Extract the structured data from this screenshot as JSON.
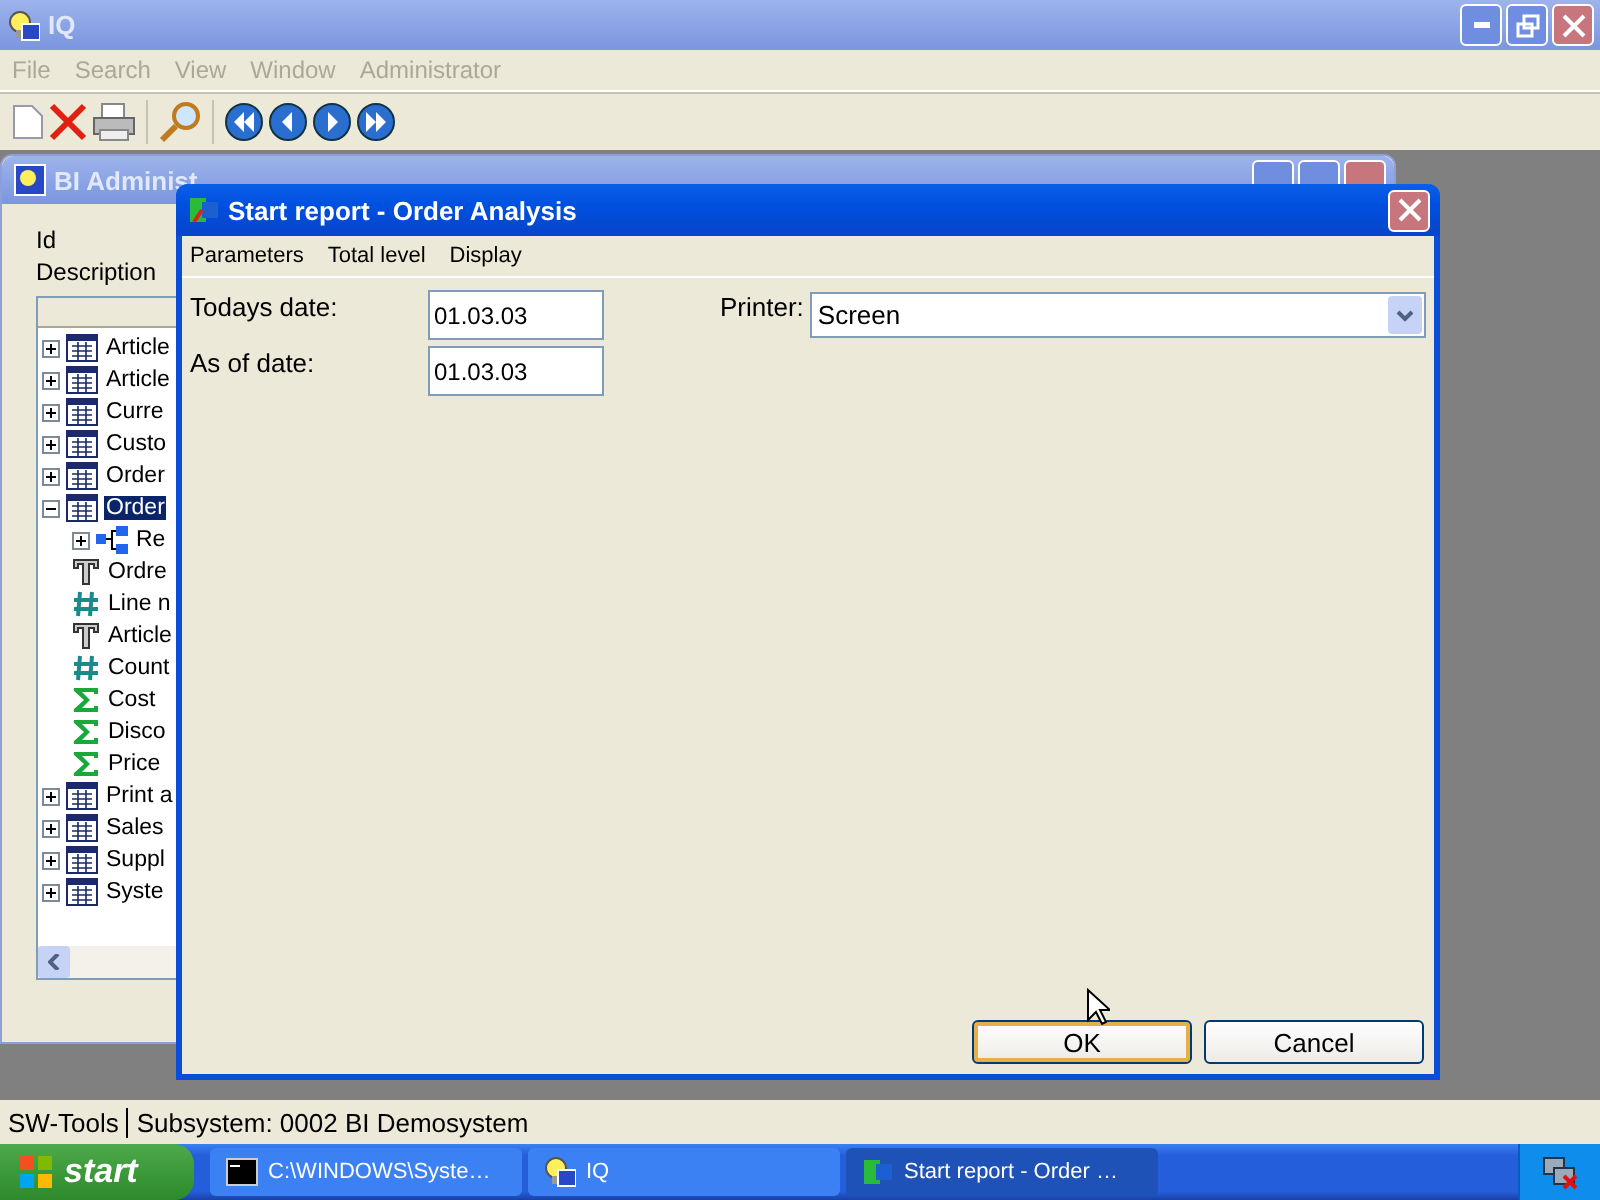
{
  "window": {
    "title": "IQ"
  },
  "menu": [
    {
      "label": "File",
      "disabled": true
    },
    {
      "label": "Search",
      "disabled": true
    },
    {
      "label": "View",
      "disabled": true
    },
    {
      "label": "Window",
      "disabled": true
    },
    {
      "label": "Administrator",
      "disabled": true
    }
  ],
  "child_window": {
    "title": "BI Administ",
    "labels": [
      "Id",
      "Description"
    ],
    "tree": [
      {
        "label": "Article",
        "kind": "table",
        "expanded": false,
        "selected": false
      },
      {
        "label": "Article",
        "kind": "table",
        "expanded": false,
        "selected": false
      },
      {
        "label": "Curre",
        "kind": "table",
        "expanded": false,
        "selected": false
      },
      {
        "label": "Custo",
        "kind": "table",
        "expanded": false,
        "selected": false
      },
      {
        "label": "Order",
        "kind": "table",
        "expanded": false,
        "selected": false
      },
      {
        "label": "Order",
        "kind": "table",
        "expanded": true,
        "selected": true,
        "children": [
          {
            "label": "Re",
            "kind": "relation",
            "expanded": false,
            "selected": false
          },
          {
            "label": "Ordre",
            "kind": "text",
            "selected": false
          },
          {
            "label": "Line n",
            "kind": "number",
            "selected": false
          },
          {
            "label": "Article",
            "kind": "text",
            "selected": false
          },
          {
            "label": "Count",
            "kind": "number",
            "selected": false
          },
          {
            "label": "Cost",
            "kind": "sum",
            "selected": false
          },
          {
            "label": "Disco",
            "kind": "sum",
            "selected": false
          },
          {
            "label": "Price",
            "kind": "sum",
            "selected": false
          }
        ]
      },
      {
        "label": "Print a",
        "kind": "table",
        "expanded": false,
        "selected": false
      },
      {
        "label": "Sales",
        "kind": "table",
        "expanded": false,
        "selected": false
      },
      {
        "label": "Suppl",
        "kind": "table",
        "expanded": false,
        "selected": false
      },
      {
        "label": "Syste",
        "kind": "table",
        "expanded": false,
        "selected": false
      }
    ]
  },
  "dialog": {
    "title": "Start report - Order Analysis",
    "menu": [
      "Parameters",
      "Total level",
      "Display"
    ],
    "fields": [
      {
        "label": "Todays date:",
        "value": "01.03.03"
      },
      {
        "label": "As of date:",
        "value": "01.03.03"
      }
    ],
    "printer": {
      "label": "Printer:",
      "value": "Screen"
    },
    "buttons": [
      {
        "label": "OK",
        "default": true
      },
      {
        "label": "Cancel",
        "default": false
      }
    ]
  },
  "status_bar": [
    "SW-Tools",
    "Subsystem: 0002 BI Demosystem"
  ],
  "taskbar": {
    "start": "start",
    "tasks": [
      {
        "label": "C:\\WINDOWS\\Syste…",
        "kind": "console",
        "selected": false
      },
      {
        "label": "IQ",
        "kind": "app",
        "selected": false
      },
      {
        "label": "Start report - Order …",
        "kind": "report",
        "selected": true
      }
    ]
  }
}
